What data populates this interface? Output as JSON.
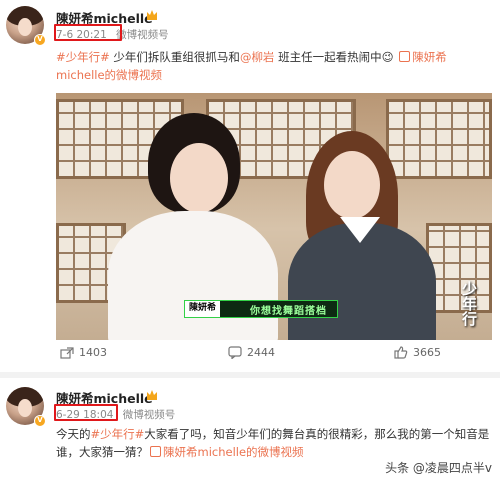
{
  "posts": [
    {
      "username": "陳妍希michelle",
      "timestamp": "7-6 20:21",
      "source": "微博视频号",
      "text": {
        "hashtag": "#少年行#",
        "part1": " 少年们拆队重组很抓马和",
        "mention": "@柳岩",
        "part2": " 班主任一起看热闹中😉 ",
        "video_link": "陳妍希michelle的微博视频"
      },
      "media": {
        "caption_name": "陳妍希",
        "caption_text": "你想找舞蹈搭档",
        "watermark": "少年行"
      },
      "actions": {
        "share_count": "1403",
        "comment_count": "2444",
        "like_count": "3665"
      }
    },
    {
      "username": "陳妍希michelle",
      "timestamp": "6-29 18:04",
      "source": "微博视频号",
      "text": {
        "part1": "今天的",
        "hashtag": "#少年行#",
        "part2": "大家看了吗，知音少年们的舞台真的很精彩，那么我的第一个知音是谁，大家猜一猜？",
        "video_link": "陳妍希michelle的微博视频"
      }
    }
  ],
  "footer_watermark": "头条 @凌晨四点半v",
  "colors": {
    "accent": "#eb7350",
    "highlight_box": "#e0181b",
    "meta": "#888888"
  }
}
